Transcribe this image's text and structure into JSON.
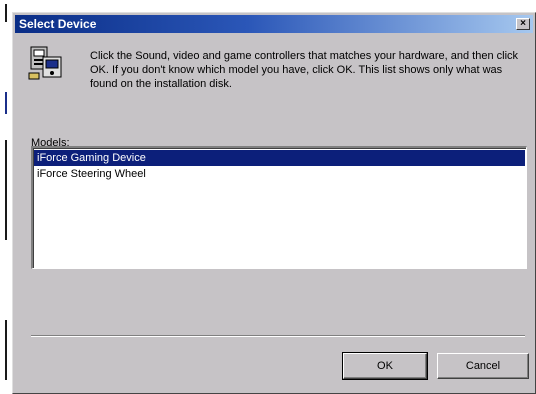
{
  "window": {
    "title": "Select Device",
    "close_glyph": "×"
  },
  "header": {
    "icon": "hardware-device-icon",
    "instructions": "Click the Sound, video and game controllers that matches your hardware, and then click OK. If you don't know which model you have, click OK. This list shows only what was found on the installation disk."
  },
  "models": {
    "label": "Models:",
    "items": [
      {
        "label": "iForce Gaming Device",
        "selected": true
      },
      {
        "label": "iForce Steering Wheel",
        "selected": false
      }
    ]
  },
  "buttons": {
    "ok_label": "OK",
    "cancel_label": "Cancel"
  },
  "colors": {
    "title_bar_start": "#0a2d86",
    "title_bar_end": "#a6c8ef",
    "selection": "#0c1f7a",
    "dialog_face": "#c6c3c6"
  }
}
